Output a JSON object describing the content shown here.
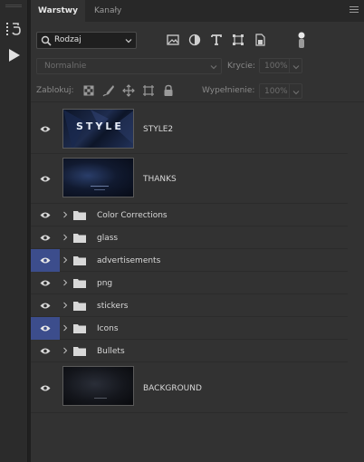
{
  "tabs": [
    {
      "label": "Warstwy",
      "active": true
    },
    {
      "label": "Kanały",
      "active": false
    }
  ],
  "filter": {
    "kind_value": "Rodzaj",
    "icons": [
      "image-filter-icon",
      "adjustment-filter-icon",
      "type-filter-icon",
      "shape-filter-icon",
      "smart-object-filter-icon"
    ]
  },
  "blend": {
    "mode": "Normalnie",
    "opacity_label": "Krycie:",
    "opacity_value": "100%"
  },
  "lock": {
    "label": "Zablokuj:",
    "icons": [
      "lock-transparent-pixels-icon",
      "lock-image-pixels-icon",
      "lock-position-icon",
      "lock-artboard-icon",
      "lock-all-icon"
    ],
    "fill_label": "Wypełnienie:",
    "fill_value": "100%"
  },
  "layers": [
    {
      "name": "STYLE2",
      "type": "image",
      "selected_eye": false,
      "thumb_text": "STYLE"
    },
    {
      "name": "THANKS",
      "type": "image",
      "selected_eye": false,
      "thumb_text": ""
    },
    {
      "name": "Color Corrections",
      "type": "group",
      "selected_eye": false
    },
    {
      "name": "glass",
      "type": "group",
      "selected_eye": false
    },
    {
      "name": "advertisements",
      "type": "group",
      "selected_eye": true
    },
    {
      "name": "png",
      "type": "group",
      "selected_eye": false
    },
    {
      "name": "stickers",
      "type": "group",
      "selected_eye": false
    },
    {
      "name": "Icons",
      "type": "group",
      "selected_eye": true
    },
    {
      "name": "Bullets",
      "type": "group",
      "selected_eye": false
    },
    {
      "name": "BACKGROUND",
      "type": "image",
      "selected_eye": false,
      "thumb_text": ""
    }
  ],
  "colors": {
    "eye_selected": "#3c4d8c",
    "panel_bg": "#323232"
  }
}
